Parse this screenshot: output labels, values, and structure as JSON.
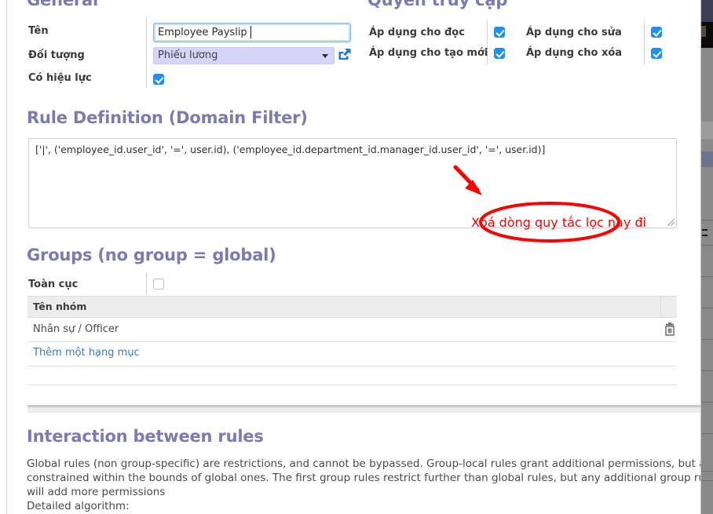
{
  "general": {
    "title": "General",
    "fields": {
      "name_label": "Tên",
      "name_value": "Employee Payslip",
      "model_label": "Đối tượng",
      "model_value": "Phiếu lương",
      "active_label": "Có hiệu lực"
    }
  },
  "access_rights": {
    "title": "Quyền truy cập",
    "items": [
      {
        "label": "Áp dụng cho đọc",
        "checked": true
      },
      {
        "label": "Áp dụng cho sửa",
        "checked": true
      },
      {
        "label": "Áp dụng cho tạo mới",
        "checked": true
      },
      {
        "label": "Áp dụng cho xóa",
        "checked": true
      }
    ]
  },
  "rule_definition": {
    "title": "Rule Definition (Domain Filter)",
    "domain": "['|', ('employee_id.user_id', '=', user.id), ('employee_id.department_id.manager_id.user_id', '=', user.id)]"
  },
  "annotation": {
    "text": "Xoá dòng quy tắc lọc này đi",
    "color": "#ff0000"
  },
  "groups": {
    "title": "Groups (no group = global)",
    "global_label": "Toàn cục",
    "global_checked": false,
    "columns": [
      "Tên nhóm"
    ],
    "rows": [
      {
        "name": "Nhân sự / Officer"
      }
    ],
    "add_link": "Thêm một hạng mục"
  },
  "interaction": {
    "title": "Interaction between rules",
    "lines": [
      "Global rules (non group-specific) are restrictions, and cannot be bypassed. Group-local rules grant additional permissions, but are",
      "constrained within the bounds of global ones. The first group rules restrict further than global rules, but any additional group rule",
      "will add more permissions",
      "Detailed algorithm:"
    ]
  },
  "theme": {
    "heading_color": "#7c7bad",
    "accent_blue": "#1e90f0",
    "link_blue": "#3b7cc4",
    "select_bg": "#d7d5f5"
  }
}
